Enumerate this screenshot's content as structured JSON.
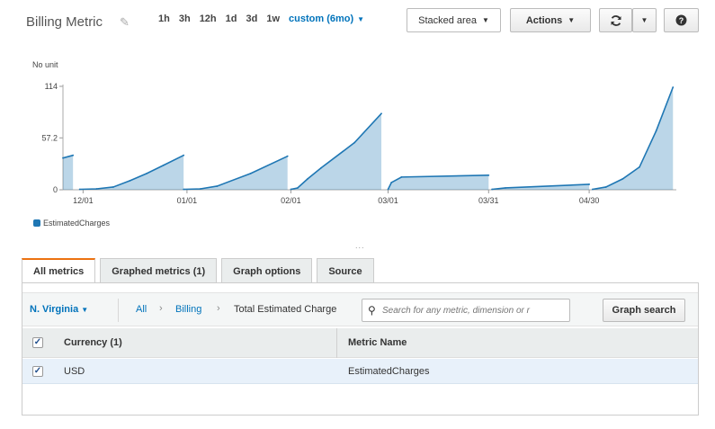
{
  "header": {
    "title": "Billing Metric",
    "time_ranges": [
      "1h",
      "3h",
      "12h",
      "1d",
      "3d",
      "1w"
    ],
    "custom_range": "custom (6mo)",
    "chart_type": "Stacked area",
    "actions_label": "Actions",
    "refresh_icon": "refresh-icon",
    "help_icon": "help-icon",
    "edit_icon": "pencil-icon"
  },
  "chart_data": {
    "type": "area",
    "ylabel": "No unit",
    "y_ticks": [
      "114",
      "57.2",
      "0"
    ],
    "ylim": [
      0,
      114
    ],
    "x_ticks": [
      "12/01",
      "01/01",
      "02/01",
      "03/01",
      "03/31",
      "04/30"
    ],
    "color": "#1f77b4",
    "series": [
      {
        "name": "EstimatedCharges",
        "points": [
          [
            "11/25",
            35
          ],
          [
            "11/28",
            38
          ],
          [
            "11/30",
            0.5
          ],
          [
            "12/05",
            1
          ],
          [
            "12/10",
            3
          ],
          [
            "12/15",
            10
          ],
          [
            "12/20",
            18
          ],
          [
            "12/25",
            27
          ],
          [
            "12/31",
            38
          ],
          [
            "12/31",
            0.5
          ],
          [
            "01/05",
            1
          ],
          [
            "01/10",
            4
          ],
          [
            "01/20",
            18
          ],
          [
            "01/31",
            37
          ],
          [
            "02/01",
            0.5
          ],
          [
            "02/03",
            2
          ],
          [
            "02/06",
            12
          ],
          [
            "02/10",
            24
          ],
          [
            "02/20",
            52
          ],
          [
            "02/28",
            84
          ],
          [
            "03/01",
            0.5
          ],
          [
            "03/02",
            8
          ],
          [
            "03/05",
            14
          ],
          [
            "03/31",
            16
          ],
          [
            "04/01",
            0.5
          ],
          [
            "04/05",
            2
          ],
          [
            "04/30",
            6
          ],
          [
            "05/01",
            0.5
          ],
          [
            "05/05",
            3
          ],
          [
            "05/10",
            12
          ],
          [
            "05/15",
            25
          ],
          [
            "05/20",
            65
          ],
          [
            "05/25",
            113
          ]
        ]
      }
    ],
    "legend_position": "bottom-left"
  },
  "tabs": [
    "All metrics",
    "Graphed metrics (1)",
    "Graph options",
    "Source"
  ],
  "active_tab": "All metrics",
  "filter": {
    "region": "N. Virginia",
    "breadcrumbs": [
      "All",
      "Billing",
      "Total Estimated Charge"
    ],
    "search_placeholder": "Search for any metric, dimension or r",
    "graph_search_label": "Graph search"
  },
  "table": {
    "columns": [
      "Currency (1)",
      "Metric Name"
    ],
    "rows": [
      {
        "currency": "USD",
        "metric": "EstimatedCharges",
        "checked": true
      }
    ]
  }
}
